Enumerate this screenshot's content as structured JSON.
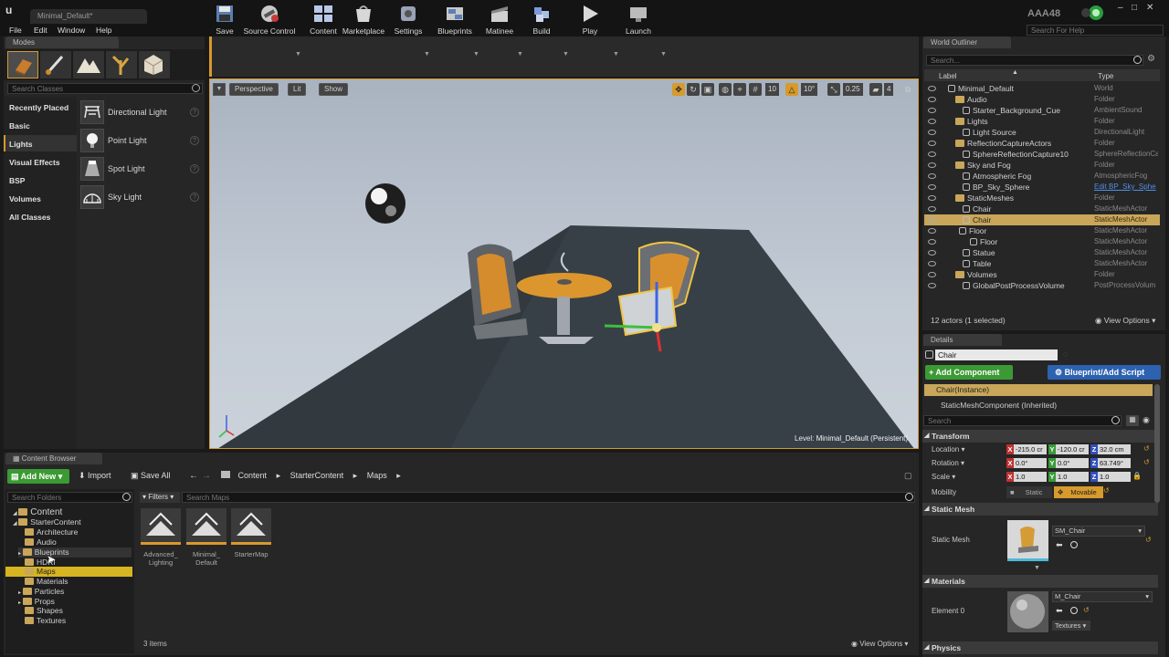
{
  "window": {
    "tab_title": "Minimal_Default*",
    "project": "AAA48",
    "help_search_placeholder": "Search For Help"
  },
  "menu": [
    "File",
    "Edit",
    "Window",
    "Help"
  ],
  "modes": {
    "tab": "Modes",
    "search_placeholder": "Search Classes",
    "categories": [
      "Recently Placed",
      "Basic",
      "Lights",
      "Visual Effects",
      "BSP",
      "Volumes",
      "All Classes"
    ],
    "items": [
      "Directional Light",
      "Point Light",
      "Spot Light",
      "Sky Light"
    ]
  },
  "toolbar": {
    "buttons": [
      "Save",
      "Source Control",
      "Content",
      "Marketplace",
      "Settings",
      "Blueprints",
      "Matinee",
      "Build",
      "Play",
      "Launch"
    ]
  },
  "viewport": {
    "perspective": "Perspective",
    "lit": "Lit",
    "show": "Show",
    "grid_snap": "10",
    "rot_snap": "10°",
    "scale_snap": "0.25",
    "cam_speed": "4",
    "level_label": "Level:",
    "level_name": "Minimal_Default (Persistent)"
  },
  "outliner": {
    "tab": "World Outliner",
    "search_placeholder": "Search...",
    "col_label": "Label",
    "col_type": "Type",
    "rows": [
      {
        "label": "Minimal_Default",
        "type": "World"
      },
      {
        "label": "Audio",
        "type": "Folder"
      },
      {
        "label": "Starter_Background_Cue",
        "type": "AmbientSound"
      },
      {
        "label": "Lights",
        "type": "Folder"
      },
      {
        "label": "Light Source",
        "type": "DirectionalLight"
      },
      {
        "label": "ReflectionCaptureActors",
        "type": "Folder"
      },
      {
        "label": "SphereReflectionCapture10",
        "type": "SphereReflectionCa"
      },
      {
        "label": "Sky and Fog",
        "type": "Folder"
      },
      {
        "label": "Atmospheric Fog",
        "type": "AtmosphericFog"
      },
      {
        "label": "BP_Sky_Sphere",
        "type": "Edit BP_Sky_Sphe"
      },
      {
        "label": "StaticMeshes",
        "type": "Folder"
      },
      {
        "label": "Chair",
        "type": "StaticMeshActor"
      },
      {
        "label": "Chair",
        "type": "StaticMeshActor"
      },
      {
        "label": "Floor",
        "type": "StaticMeshActor"
      },
      {
        "label": "Floor",
        "type": "StaticMeshActor"
      },
      {
        "label": "Statue",
        "type": "StaticMeshActor"
      },
      {
        "label": "Table",
        "type": "StaticMeshActor"
      },
      {
        "label": "Volumes",
        "type": "Folder"
      },
      {
        "label": "GlobalPostProcessVolume",
        "type": "PostProcessVolum"
      }
    ],
    "status": "12 actors (1 selected)",
    "view_options": "View Options"
  },
  "details": {
    "tab": "Details",
    "name_value": "Chair",
    "add_component": "+ Add Component",
    "blueprint_script": "Blueprint/Add Script",
    "instance": "Chair(Instance)",
    "component": "StaticMeshComponent (Inherited)",
    "search_placeholder": "Search",
    "transform": "Transform",
    "location_label": "Location",
    "rotation_label": "Rotation",
    "scale_label": "Scale",
    "mobility_label": "Mobility",
    "location": [
      "-215.0 cr",
      "-120.0 cr",
      "32.0 cm"
    ],
    "rotation": [
      "0.0°",
      "0.0°",
      "63.749°"
    ],
    "scale": [
      "1.0",
      "1.0",
      "1.0"
    ],
    "mobility_static": "Static",
    "mobility_movable": "Movable",
    "static_mesh_section": "Static Mesh",
    "static_mesh_label": "Static Mesh",
    "static_mesh_value": "SM_Chair",
    "materials_section": "Materials",
    "element0_label": "Element 0",
    "material_value": "M_Chair",
    "textures": "Textures",
    "physics_section": "Physics"
  },
  "content_browser": {
    "tab": "Content Browser",
    "add_new": "Add New",
    "import": "Import",
    "save_all": "Save All",
    "path": [
      "Content",
      "StarterContent",
      "Maps"
    ],
    "search_folders_placeholder": "Search Folders",
    "filters": "Filters",
    "search_maps_placeholder": "Search Maps",
    "tree": [
      "Content",
      "StarterContent",
      "Architecture",
      "Audio",
      "Blueprints",
      "HDRI",
      "Maps",
      "Materials",
      "Particles",
      "Props",
      "Shapes",
      "Textures"
    ],
    "assets": [
      {
        "name_line1": "Advanced_",
        "name_line2": "Lighting"
      },
      {
        "name_line1": "Minimal_",
        "name_line2": "Default"
      },
      {
        "name_line1": "StarterMap",
        "name_line2": ""
      }
    ],
    "count": "3 items",
    "view_options": "View Options"
  },
  "colors": {
    "accent_orange": "#d69a2d",
    "selection": "#c9a65a",
    "add_green": "#3b9a33",
    "blueprint_blue": "#2c62b0"
  }
}
